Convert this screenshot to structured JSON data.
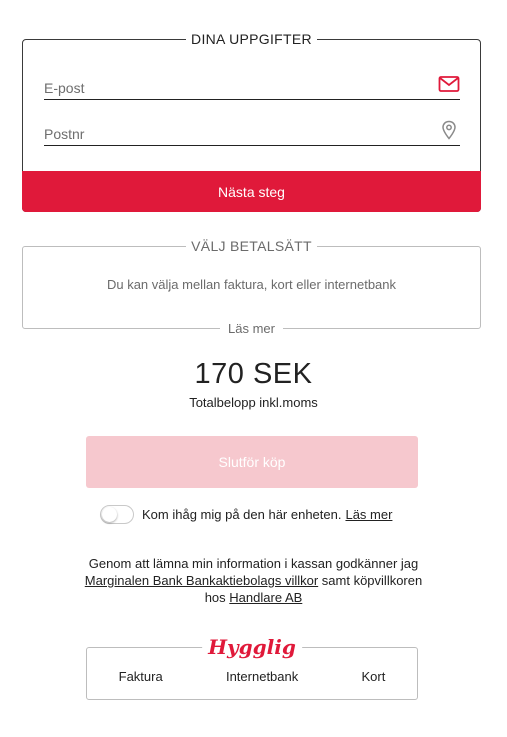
{
  "details": {
    "legend": "DINA UPPGIFTER",
    "email_placeholder": "E-post",
    "email_value": "",
    "email_icon": "mail-icon",
    "zip_placeholder": "Postnr",
    "zip_value": "",
    "zip_icon": "location-pin-icon",
    "next_label": "Nästa steg"
  },
  "payment": {
    "legend": "VÄLJ BETALSÄTT",
    "description": "Du kan välja mellan faktura, kort eller internetbank",
    "read_more": "Läs mer"
  },
  "total": {
    "amount": "170 SEK",
    "label": "Totalbelopp inkl.moms"
  },
  "complete_label": "Slutför köp",
  "remember": {
    "text": "Kom ihåg mig på den här enheten.",
    "link": "Läs mer",
    "enabled": false
  },
  "terms": {
    "part1": "Genom att lämna min information i kassan godkänner jag",
    "link1": "Marginalen Bank Bankaktiebolags villkor",
    "part2": "samt köpvillkoren",
    "part3": "hos",
    "link2": "Handlare AB"
  },
  "hygglig": {
    "logo": "Hygglig",
    "methods": [
      "Faktura",
      "Internetbank",
      "Kort"
    ]
  },
  "colors": {
    "brand_red": "#e0193a",
    "disabled_pink": "#f6c8ce"
  }
}
